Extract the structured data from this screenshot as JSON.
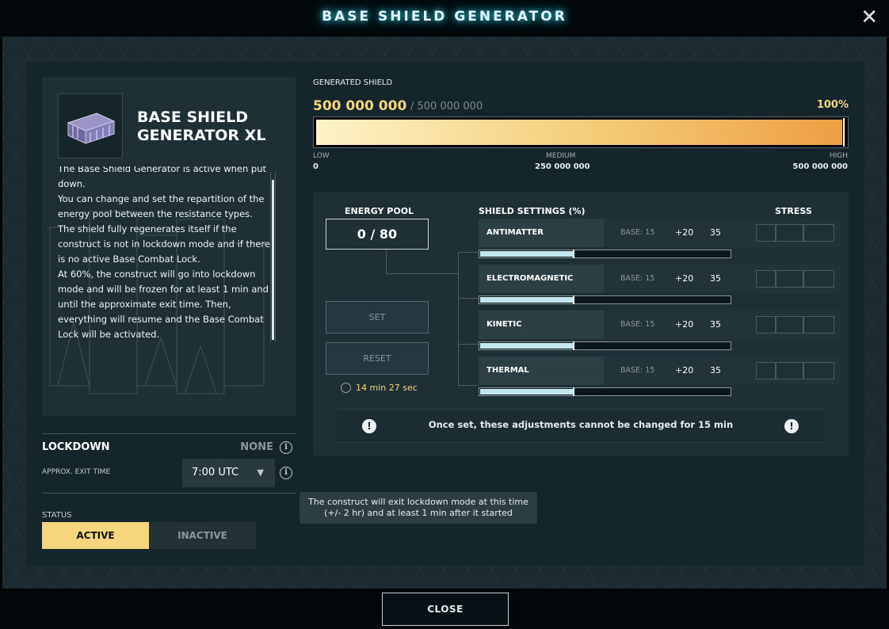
{
  "window": {
    "title": "BASE SHIELD GENERATOR",
    "close_icon": "close-icon"
  },
  "element": {
    "name": "BASE SHIELD GENERATOR XL",
    "description": [
      "The Base Shield Generator is active when put",
      "down.",
      "You can change and set the repartition of the",
      "energy pool between the resistance types.",
      "The shield fully regenerates itself if the",
      "construct is not in lockdown mode and if there",
      "is no active Base Combat Lock.",
      "At 60%, the construct will go into lockdown",
      "mode and will be frozen for at least 1 min and",
      "until the approximate exit time. Then,",
      "everything will resume and the Base Combat",
      "Lock will be activated."
    ]
  },
  "lockdown": {
    "label": "LOCKDOWN",
    "value": "NONE",
    "exit_label": "APPROX. EXIT TIME",
    "exit_time": "7:00 UTC"
  },
  "status": {
    "label": "STATUS",
    "active": "ACTIVE",
    "inactive": "INACTIVE",
    "selected": "ACTIVE"
  },
  "shield": {
    "label": "GENERATED SHIELD",
    "current": "500 000 000",
    "max": "/ 500 000 000",
    "percent_text": "100%",
    "fill_fraction": 1.0,
    "scale": {
      "low_label": "LOW",
      "low_value": "0",
      "medium_label": "MEDIUM",
      "medium_value": "250 000 000",
      "high_label": "HIGH",
      "high_value": "500 000 000"
    }
  },
  "energy_pool": {
    "label": "ENERGY POOL",
    "value": "0 / 80"
  },
  "settings": {
    "label": "SHIELD SETTINGS (%)",
    "stress_label": "STRESS",
    "set_label": "SET",
    "reset_label": "RESET",
    "timer": "14 min 27 sec",
    "resistances": [
      {
        "name": "ANTIMATTER",
        "base": "BASE: 15",
        "added": "+20",
        "total": "35",
        "fill_fraction": 0.37
      },
      {
        "name": "ELECTROMAGNETIC",
        "base": "BASE: 15",
        "added": "+20",
        "total": "35",
        "fill_fraction": 0.37
      },
      {
        "name": "KINETIC",
        "base": "BASE: 15",
        "added": "+20",
        "total": "35",
        "fill_fraction": 0.37
      },
      {
        "name": "THERMAL",
        "base": "BASE: 15",
        "added": "+20",
        "total": "35",
        "fill_fraction": 0.37
      }
    ],
    "warning": "Once set, these adjustments cannot be changed for 15 min"
  },
  "tooltip": {
    "line1": "The construct will exit lockdown mode at this time",
    "line2": "(+/- 2 hr) and at least 1 min after it started"
  },
  "footer": {
    "close_label": "CLOSE"
  },
  "colors": {
    "accent": "#f6d57f",
    "glow": "#2fd0e6",
    "panel": "#14252b",
    "bar_fill": "#c3e7ef"
  }
}
